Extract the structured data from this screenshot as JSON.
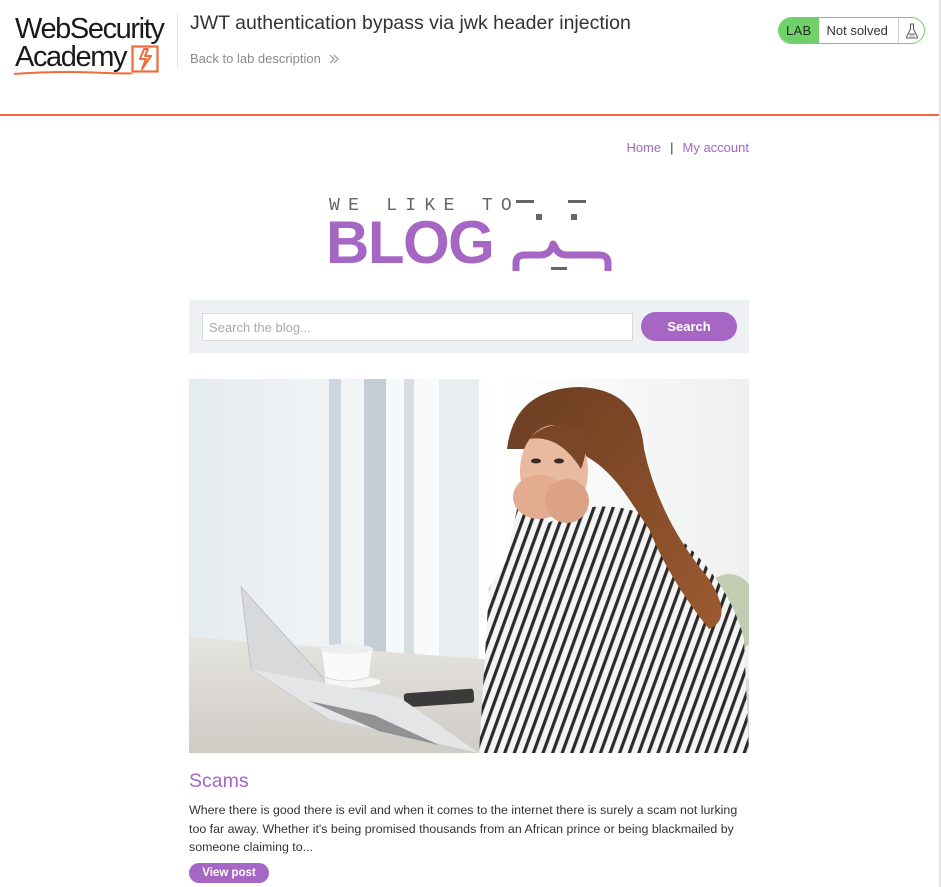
{
  "academy": {
    "logo_line1": "WebSecurity",
    "logo_line2": "Academy",
    "lab_title": "JWT authentication bypass via jwk header injection",
    "back_label": "Back to lab description",
    "lab_badge": "LAB",
    "lab_status": "Not solved",
    "accent_color": "#ef6c3a",
    "status_color": "#70d16a",
    "status_icon": "flask-icon"
  },
  "nav": {
    "items": [
      {
        "label": "Home"
      },
      {
        "label": "My account"
      }
    ],
    "separator": "|"
  },
  "banner": {
    "tagline": "WE LIKE TO",
    "word": "BLOG",
    "icon": "emoji-face-icon"
  },
  "search": {
    "placeholder": "Search the blog...",
    "value": "",
    "button_label": "Search"
  },
  "post": {
    "title": "Scams",
    "excerpt": "Where there is good there is evil and when it comes to the internet there is surely a scam not lurking too far away. Whether it's being promised thousands from an African prince or being blackmailed by someone claiming to...",
    "button_label": "View post",
    "image": "woman-shocked-at-laptop-photo"
  },
  "theme": {
    "brand_purple": "#a566c4",
    "search_bg": "#eef1f3"
  }
}
